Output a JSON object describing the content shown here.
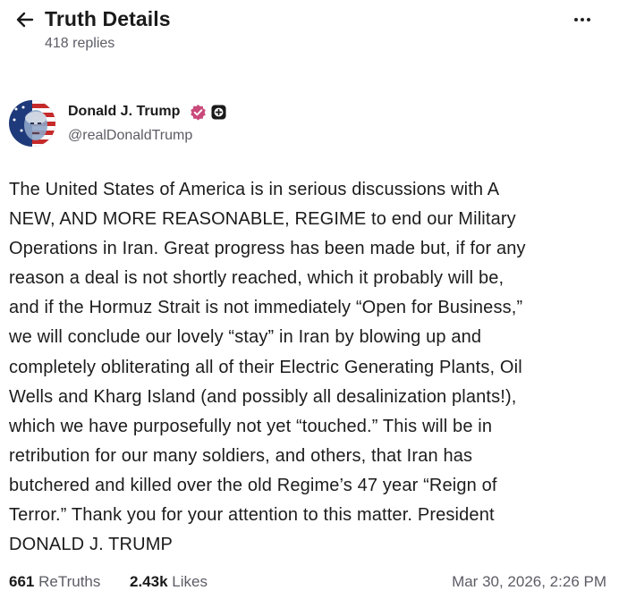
{
  "header": {
    "title": "Truth Details",
    "subtitle": "418 replies",
    "back_icon": "arrow-left-icon",
    "more_icon": "more-horizontal-icon"
  },
  "author": {
    "name": "Donald J. Trump",
    "handle": "@realDonaldTrump",
    "verified_icon": "verified-badge-icon",
    "plus_icon": "plus-badge-icon",
    "colors": {
      "verified": "#c94a7a"
    }
  },
  "post": {
    "lines": [
      "The United States of America is in serious discussions with A",
      "NEW, AND MORE REASONABLE, REGIME to end our Military",
      "Operations in Iran. Great progress has been made but, if for any",
      "reason a deal is not shortly reached, which it probably will be,",
      "and if the Hormuz Strait is not immediately “Open for Business,”",
      "we will conclude our lovely “stay” in Iran by blowing up and",
      "completely obliterating all of their Electric Generating Plants, Oil",
      "Wells and Kharg Island (and possibly all desalinization plants!),",
      "which we have purposefully not yet “touched.” This will be in",
      "retribution for our many soldiers, and others, that Iran has",
      "butchered and killed over the old Regime’s 47 year “Reign of",
      "Terror.” Thank you for your attention to this matter. President",
      "DONALD J. TRUMP"
    ]
  },
  "stats": {
    "retruths_count": "661",
    "retruths_label": "ReTruths",
    "likes_count": "2.43k",
    "likes_label": "Likes",
    "timestamp": "Mar 30, 2026, 2:26 PM"
  }
}
